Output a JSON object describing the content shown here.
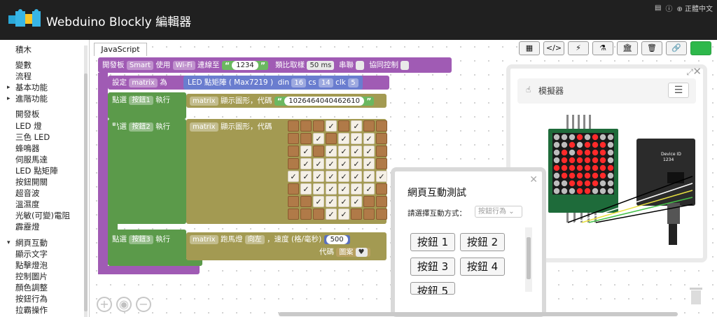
{
  "app": {
    "title": "Webduino Blockly 編輯器",
    "top_right": [
      "▤",
      "ⓘ",
      "⊕ 正體中文"
    ]
  },
  "sidebar": {
    "items": [
      {
        "label": "積木",
        "style": "plain"
      },
      {
        "label": "變數",
        "style": "gap"
      },
      {
        "label": "流程",
        "style": "plain"
      },
      {
        "label": "基本功能",
        "style": "arrow"
      },
      {
        "label": "進階功能",
        "style": "arrow"
      },
      {
        "label": "開發板",
        "style": "gap"
      },
      {
        "label": "LED 燈",
        "style": "plain"
      },
      {
        "label": "三色 LED",
        "style": "plain"
      },
      {
        "label": "蜂鳴器",
        "style": "plain"
      },
      {
        "label": "伺服馬達",
        "style": "plain"
      },
      {
        "label": "LED 點矩陣",
        "style": "plain"
      },
      {
        "label": "按鈕開關",
        "style": "plain"
      },
      {
        "label": "超音波",
        "style": "plain"
      },
      {
        "label": "溫濕度",
        "style": "plain"
      },
      {
        "label": "光敏(可變)電阻",
        "style": "plain"
      },
      {
        "label": "霹靂燈",
        "style": "plain"
      },
      {
        "label": "網頁互動",
        "style": "down-gap"
      },
      {
        "label": "顯示文字",
        "style": "plain"
      },
      {
        "label": "點擊燈泡",
        "style": "plain"
      },
      {
        "label": "控制圖片",
        "style": "plain"
      },
      {
        "label": "顏色調整",
        "style": "plain"
      },
      {
        "label": "按鈕行為",
        "style": "plain"
      },
      {
        "label": "拉霸操作",
        "style": "plain"
      }
    ]
  },
  "workspace": {
    "tab_label": "JavaScript",
    "toolbar": [
      "▦",
      "</>",
      "⚡",
      "⚗",
      "🏛",
      "🗑",
      "🔗",
      ""
    ],
    "board_block": {
      "open": "開發板",
      "board_type": "Smart",
      "use": "使用",
      "conn": "Wi-Fi",
      "connect_to": "連線至",
      "device_id": "1234",
      "sampling": "類比取樣",
      "sample_ms": "50 ms",
      "serial": "串聯",
      "coop": "協同控制"
    },
    "set_block": {
      "set": "設定",
      "var": "matrix",
      "as": "為",
      "led_matrix": "LED 點矩陣 ( Max7219 )",
      "din_label": "din",
      "din": "16",
      "cs_label": "cs",
      "cs": "14",
      "clk_label": "clk",
      "clk": "5"
    },
    "click1": {
      "click": "點選",
      "button": "按鈕1",
      "exec": "執行",
      "var": "matrix",
      "action": "顯示圖形，代碼",
      "code": "1026464040462610"
    },
    "click2": {
      "click": "點選",
      "button": "按鈕2",
      "exec": "執行",
      "var": "matrix",
      "action": "顯示圖形，代碼"
    },
    "grid_check": "✓",
    "grid": [
      [
        0,
        0,
        0,
        1,
        0,
        1,
        0,
        0
      ],
      [
        0,
        0,
        1,
        0,
        1,
        1,
        1,
        0
      ],
      [
        0,
        1,
        0,
        1,
        1,
        1,
        1,
        0
      ],
      [
        0,
        1,
        1,
        1,
        1,
        1,
        1,
        0
      ],
      [
        1,
        1,
        1,
        1,
        1,
        1,
        1,
        1
      ],
      [
        0,
        1,
        1,
        1,
        1,
        1,
        1,
        0
      ],
      [
        0,
        0,
        1,
        1,
        1,
        1,
        0,
        0
      ],
      [
        0,
        0,
        0,
        1,
        1,
        0,
        0,
        0
      ]
    ],
    "click3": {
      "click": "點選",
      "button": "按鈕3",
      "exec": "執行",
      "var": "matrix",
      "action": "跑馬燈",
      "dir": "向左",
      "speed_label": "，速度 (格/毫秒)",
      "speed": "500",
      "code_label": "代碼",
      "pattern": "圖案",
      "heart": "♥"
    }
  },
  "simulator": {
    "title": "模擬器",
    "menu_icon": "☰",
    "board_label": "Device ID",
    "board_id": "1234"
  },
  "popup": {
    "title": "網頁互動測試",
    "label": "請選擇互動方式：",
    "select_placeholder": "按鈕行為",
    "buttons": [
      "按鈕 1",
      "按鈕 2",
      "按鈕 3",
      "按鈕 4",
      "按鈕 5"
    ]
  },
  "colors": {
    "topbar": "#202020",
    "board_block": "#a05bb4",
    "loop_block": "#5b9a4a",
    "led_block": "#6a7dcf",
    "matrix_block": "#a39a52",
    "grid_on": "#f5f0e6",
    "grid_off": "#b07a48"
  }
}
